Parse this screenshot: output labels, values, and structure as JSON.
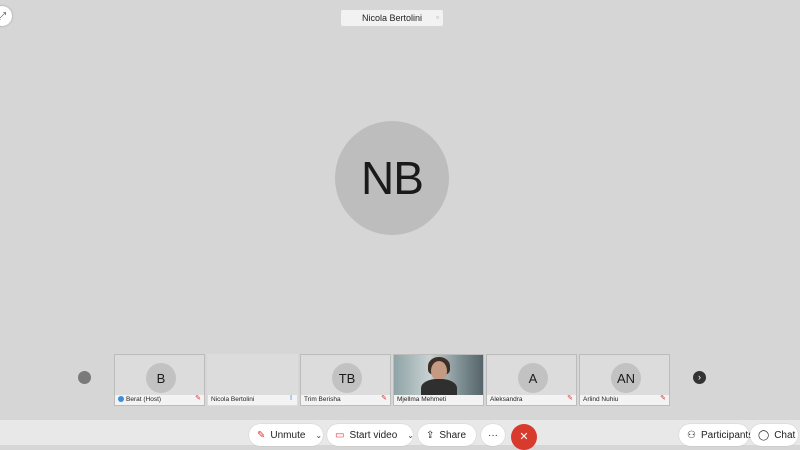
{
  "speaker": {
    "name": "Nicola Bertolini",
    "initials": "NB"
  },
  "gallery": {
    "participants": [
      {
        "initials": "B",
        "name": "Berat (Host)"
      },
      {
        "initials": "",
        "name": "Nicola Bertolini"
      },
      {
        "initials": "TB",
        "name": "Trim Berisha"
      },
      {
        "initials": "",
        "name": "Mjellma Mehmeti"
      },
      {
        "initials": "A",
        "name": "Aleksandra"
      },
      {
        "initials": "AN",
        "name": "Arlind Nuhiu"
      }
    ]
  },
  "toolbar": {
    "unmute_label": "Unmute",
    "start_video_label": "Start video",
    "share_label": "Share",
    "more_label": "···",
    "participants_label": "Participants",
    "chat_label": "Chat"
  },
  "colors": {
    "background": "#d6d6d6",
    "leave_button": "#d83a2e",
    "muted_icon": "#dd3333"
  }
}
